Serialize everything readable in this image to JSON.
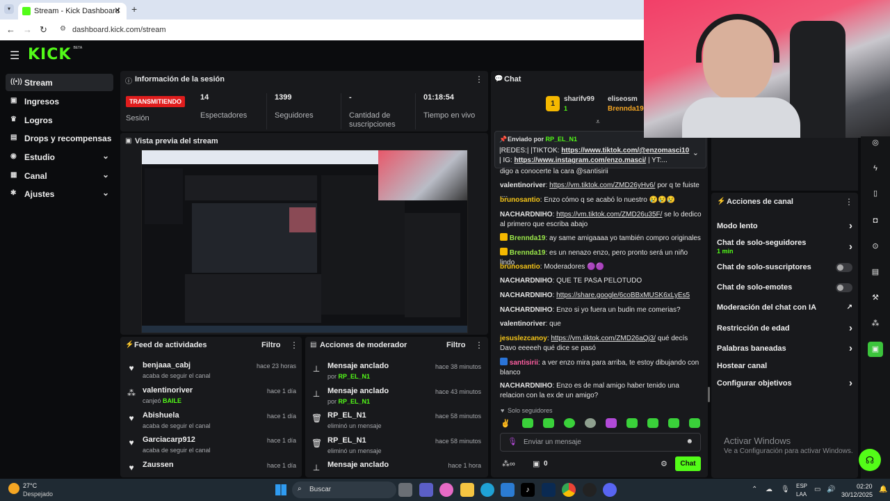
{
  "browser": {
    "tab_title": "Stream - Kick Dashboard",
    "url": "dashboard.kick.com/stream"
  },
  "logo": {
    "text": "KICK",
    "badge": "BETA"
  },
  "nav": {
    "items": [
      {
        "label": "Stream",
        "icon": "broadcast-icon"
      },
      {
        "label": "Ingresos",
        "icon": "money-icon"
      },
      {
        "label": "Logros",
        "icon": "trophy-icon"
      },
      {
        "label": "Drops y recompensas",
        "icon": "gift-icon"
      },
      {
        "label": "Estudio",
        "icon": "palette-icon"
      },
      {
        "label": "Canal",
        "icon": "channel-icon"
      },
      {
        "label": "Ajustes",
        "icon": "gear-icon"
      }
    ]
  },
  "session": {
    "title": "Información de la sesión",
    "live_badge": "TRANSMITIENDO",
    "session_label": "Sesión",
    "stats": [
      {
        "value": "14",
        "label": "Espectadores"
      },
      {
        "value": "1399",
        "label": "Seguidores"
      },
      {
        "value": "-",
        "label": "Cantidad de suscripciones"
      },
      {
        "value": "01:18:54",
        "label": "Tiempo en vivo"
      }
    ]
  },
  "preview": {
    "title": "Vista previa del stream"
  },
  "feed": {
    "title": "Feed de actividades",
    "filter": "Filtro",
    "items": [
      {
        "user": "benjaaa_cabj",
        "sub": "acaba de seguir el canal",
        "time": "hace 23 horas",
        "icon": "heart-icon"
      },
      {
        "user": "valentinoriver",
        "sub_prefix": "canjeó",
        "sub_highlight": "BAILE",
        "time": "hace 1 día",
        "icon": "points-icon"
      },
      {
        "user": "Abishuela",
        "sub": "acaba de seguir el canal",
        "time": "hace 1 día",
        "icon": "heart-icon"
      },
      {
        "user": "Garciacarp912",
        "sub": "acaba de seguir el canal",
        "time": "hace 1 día",
        "icon": "heart-icon"
      },
      {
        "user": "Zaussen",
        "sub": "",
        "time": "hace 1 día",
        "icon": "heart-icon"
      }
    ]
  },
  "modactions": {
    "title": "Acciones de moderador",
    "filter": "Filtro",
    "items": [
      {
        "title": "Mensaje anclado",
        "sub_prefix": "por",
        "sub_highlight": "RP_EL_N1",
        "time": "hace 38 minutos",
        "icon": "pin-icon"
      },
      {
        "title": "Mensaje anclado",
        "sub_prefix": "por",
        "sub_highlight": "RP_EL_N1",
        "time": "hace 43 minutos",
        "icon": "pin-icon"
      },
      {
        "title": "RP_EL_N1",
        "sub": "eliminó un mensaje",
        "time": "hace 58 minutos",
        "icon": "trash-icon"
      },
      {
        "title": "RP_EL_N1",
        "sub": "eliminó un mensaje",
        "time": "hace 58 minutos",
        "icon": "trash-icon"
      },
      {
        "title": "Mensaje anclado",
        "sub": "",
        "time": "hace 1 hora",
        "icon": "pin-icon"
      }
    ]
  },
  "chat": {
    "title": "Chat",
    "top_gifters": [
      {
        "rank": "1",
        "name": "sharifv99",
        "count": "1"
      },
      {
        "name": "eliseosm"
      },
      {
        "name": "Brennda19"
      }
    ],
    "pinned": {
      "sent_by_label": "Enviado por",
      "sender": "RP_EL_N1",
      "text_1": "|REDES:| |TIKTOK: ",
      "link_1": "https://www.tiktok.com/@enzomasci10",
      "text_2": " | IG: ",
      "link_2": "https://www.instagram.com/enzo.masci/",
      "text_3": " | YT:..."
    },
    "messages": [
      {
        "user": "",
        "text": "digo a conocerte la cara @santisirii",
        "cls": ""
      },
      {
        "user": "valentinoriver",
        "link": "https://vm.tiktok.com/ZMD26yHv6/",
        "text": " por q te fuiste ....",
        "cls": "u-white"
      },
      {
        "user": "brunosantio",
        "text": " Enzo cómo q se acabó lo nuestro 😢😢😢",
        "cls": "u-yellow"
      },
      {
        "user": "NACHARDNIHO",
        "link": "https://vm.tiktok.com/ZMD26u35F/",
        "text": " se lo dedico al primero que escriba abajo",
        "cls": "u-white"
      },
      {
        "user": "Brennda19",
        "text": " ay same amigaaaa yo también compro originales",
        "cls": "u-lime"
      },
      {
        "user": "Brennda19",
        "text": " es un nenazo enzo, pero pronto será un niño lindo",
        "cls": "u-lime"
      },
      {
        "user": "brunosantio",
        "text": " Moderadores 🟣🟣",
        "cls": "u-yellow"
      },
      {
        "user": "NACHARDNIHO",
        "text": " QUE TE PASA PELOTUDO",
        "cls": "u-white"
      },
      {
        "user": "NACHARDNIHO",
        "link": "https://share.google/6coBBxMUSK6xLyEs5",
        "text": "",
        "cls": "u-white"
      },
      {
        "user": "NACHARDNIHO",
        "text": " Enzo si yo fuera un budin me comerias?",
        "cls": "u-white"
      },
      {
        "user": "valentinoriver",
        "text": " que",
        "cls": "u-white"
      },
      {
        "user": "jesuslezcanoy",
        "link": "https://vm.tiktok.com/ZMD26aQj3/",
        "text": " qué decís Davo eeeeeh qué dice se pasó",
        "cls": "u-yellow"
      },
      {
        "user": "santisirii",
        "text": " a ver enzo mira para arriba, te estoy dibujando con blanco",
        "cls": "u-pink"
      },
      {
        "user": "NACHARDNIHO",
        "text": " Enzo es de mal amigo haber tenido una relacion con la ex de un amigo?",
        "cls": "u-white"
      }
    ],
    "mode_label": "Solo seguidores",
    "input_placeholder": "Enviar un mensaje",
    "points": "0",
    "send_label": "Chat"
  },
  "channel_actions": {
    "title": "Acciones de canal",
    "items": [
      {
        "label": "Modo lento",
        "control": "chevron"
      },
      {
        "label": "Chat de solo-seguidores",
        "sub": "1 min",
        "control": "chevron"
      },
      {
        "label": "Chat de solo-suscriptores",
        "control": "toggle",
        "on": false
      },
      {
        "label": "Chat de solo-emotes",
        "control": "toggle",
        "on": false
      },
      {
        "label": "Moderación del chat con IA",
        "control": "external"
      },
      {
        "label": "Restricción de edad",
        "control": "chevron"
      },
      {
        "label": "Palabras baneadas",
        "control": "chevron"
      },
      {
        "label": "Hostear canal",
        "control": "none"
      },
      {
        "label": "Configurar objetivos",
        "control": "chevron"
      }
    ]
  },
  "watermark": {
    "title": "Activar Windows",
    "sub": "Ve a Configuración para activar Windows."
  },
  "taskbar": {
    "weather_temp": "27°C",
    "weather_desc": "Despejado",
    "search": "Buscar",
    "lang_1": "ESP",
    "lang_2": "LAA",
    "time": "02:20",
    "date": "30/12/2025"
  },
  "colors": {
    "accent": "#53fc18",
    "live": "#e01d1d",
    "panel": "#18191c"
  }
}
